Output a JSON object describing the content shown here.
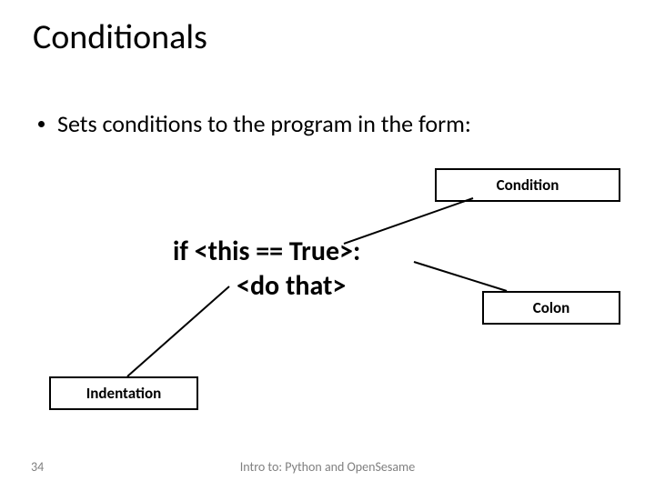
{
  "title": "Conditionals",
  "bullet": "Sets conditions to the program in the form:",
  "code": {
    "line1": "if <this == True>:",
    "line2": "<do that>"
  },
  "labels": {
    "condition": "Condition",
    "colon": "Colon",
    "indentation": "Indentation"
  },
  "page_number": "34",
  "footer": "Intro to: Python and OpenSesame"
}
